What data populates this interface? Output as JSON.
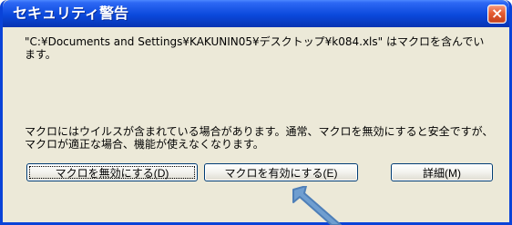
{
  "dialog": {
    "title": "セキュリティ警告",
    "message": "\"C:¥Documents and Settings¥KAKUNIN05¥デスクトップ¥k084.xls\" はマクロを含んでいます。",
    "warning": "マクロにはウイルスが含まれている場合があります。通常、マクロを無効にすると安全ですが、マクロが適正な場合、機能が使えなくなります。"
  },
  "buttons": {
    "disable": "マクロを無効にする(D)",
    "enable": "マクロを有効にする(E)",
    "details": "詳細(M)"
  },
  "icons": {
    "close": "close-icon",
    "pointer": "cursor-arrow-icon"
  },
  "colors": {
    "title_bar": "#0b49dc",
    "dialog_background": "#ece9d8",
    "close_button": "#e55c32",
    "cursor_arrow": "#6f9ed0"
  }
}
